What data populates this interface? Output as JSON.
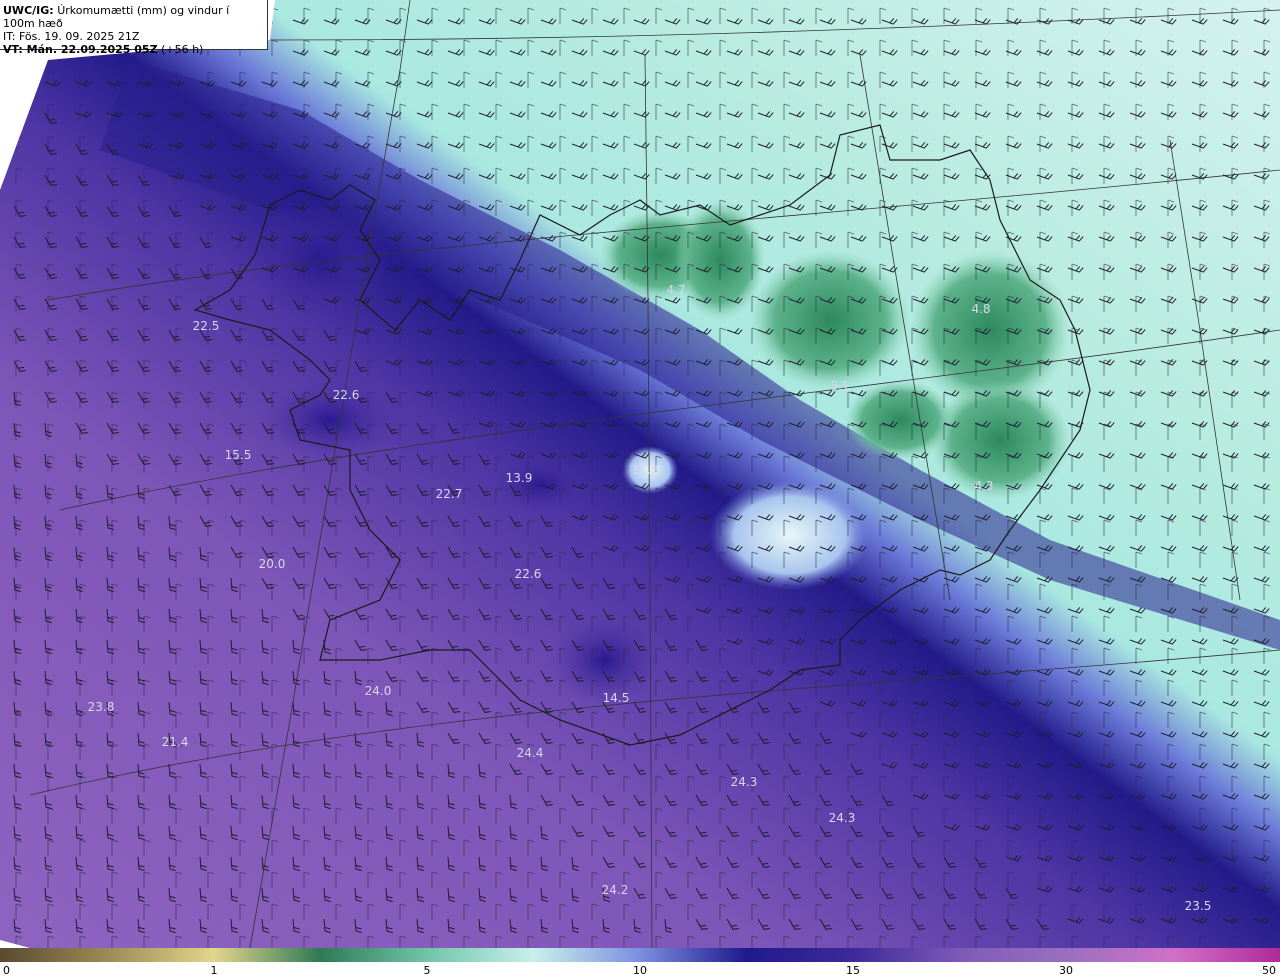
{
  "header": {
    "model": "UWC/IG:",
    "variable": "Úrkomumætti (mm) og vindur í 100m hæð",
    "init_time": "IT: Fös. 19. 09. 2025 21Z",
    "valid_label": "VT: Mán. 22.09.2025 05Z",
    "lead": "(+56 h)"
  },
  "value_labels": [
    "22.5",
    "22.6",
    "15.5",
    "22.7",
    "13.9",
    "11.8",
    "4.7",
    "5.1",
    "4.8",
    "4.3",
    "20.0",
    "22.6",
    "23.8",
    "21.4",
    "24.0",
    "14.5",
    "24.4",
    "24.3",
    "24.3",
    "24.2",
    "23.5"
  ],
  "colorbar": {
    "ticks": [
      "0",
      "1",
      "5",
      "10",
      "15",
      "30",
      "50"
    ],
    "colors": [
      "#5b4a30",
      "#9b8a55",
      "#e3d58a",
      "#2f7a55",
      "#6fc4a8",
      "#c8f0ec",
      "#7b8fe0",
      "#1f1a8c",
      "#3e2a9a",
      "#7e5ab8",
      "#9a6fc0",
      "#d070c8",
      "#b02a9a"
    ]
  }
}
